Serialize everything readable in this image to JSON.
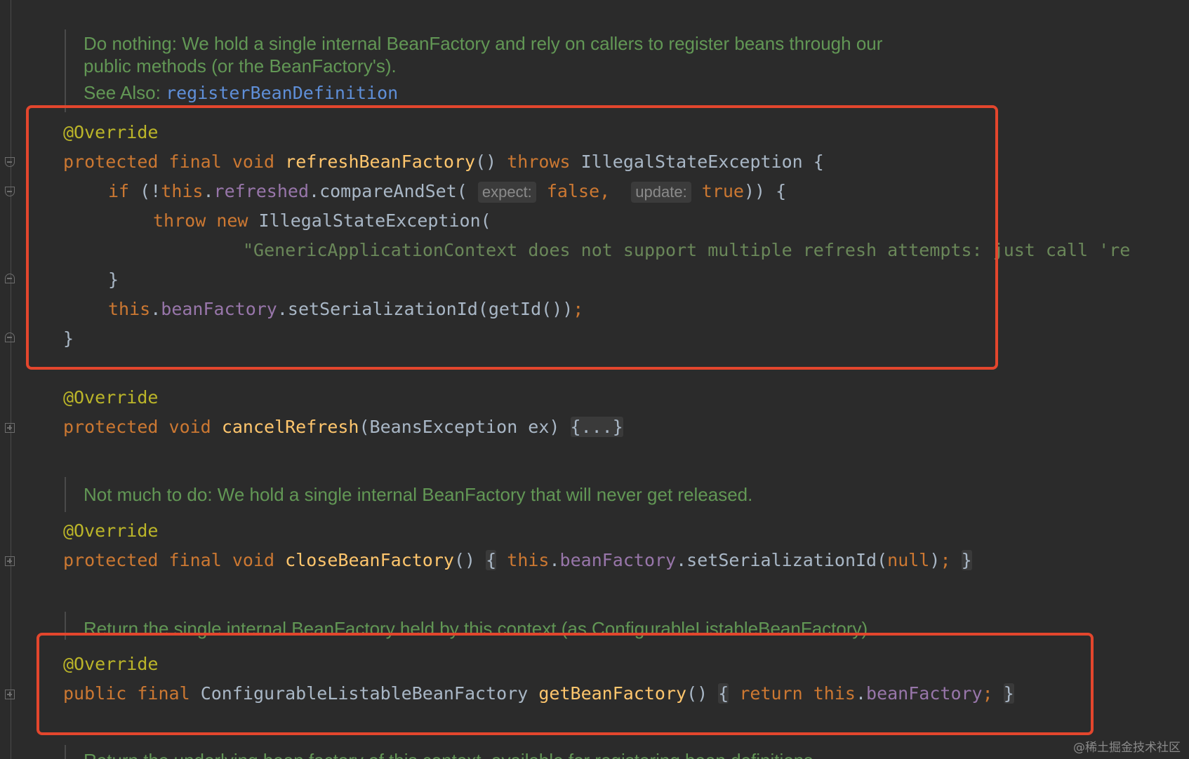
{
  "colors": {
    "background": "#2b2b2b",
    "annotation": "#bbb529",
    "keyword": "#cc7832",
    "method": "#ffc66d",
    "field": "#9876aa",
    "string": "#6a8759",
    "doc_comment": "#629755",
    "highlight_box": "#e3462d"
  },
  "doc1": {
    "line1": "Do nothing: We hold a single internal BeanFactory and rely on callers to register beans through our",
    "line2": "public methods (or the BeanFactory's).",
    "see_also_label": "See Also: ",
    "see_also_link": "registerBeanDefinition"
  },
  "refresh": {
    "annotation": "@Override",
    "kw_protected": "protected",
    "kw_final": "final",
    "kw_void": "void",
    "name": "refreshBeanFactory",
    "parens": "()",
    "kw_throws": "throws",
    "exception_type": "IllegalStateException {",
    "if_kw": "if",
    "if_open": " (!",
    "this1": "this",
    "dot1": ".",
    "field_refreshed": "refreshed",
    "cas_call": ".compareAndSet(",
    "hint_expect": "expect:",
    "val_false": "false",
    "comma": ",",
    "hint_update": "update:",
    "val_true": "true",
    "if_close": ")) {",
    "throw_kw": "throw",
    "new_kw": "new",
    "new_type": "IllegalStateException(",
    "message": "\"GenericApplicationContext does not support multiple refresh attempts: just call 're",
    "close_inner": "}",
    "this2": "this",
    "dot2": ".",
    "field_beanFactory": "beanFactory",
    "set_call": ".setSerializationId(getId())",
    "semicolon": ";",
    "close_outer": "}"
  },
  "cancel": {
    "annotation": "@Override",
    "kw_protected": "protected",
    "kw_void": "void",
    "name": "cancelRefresh",
    "params": "(BeansException ex)",
    "folded": "{...}"
  },
  "doc2": {
    "line1": "Not much to do: We hold a single internal BeanFactory that will never get released."
  },
  "close": {
    "annotation": "@Override",
    "kw_protected": "protected",
    "kw_final": "final",
    "kw_void": "void",
    "name": "closeBeanFactory",
    "parens": "()",
    "open_brace": "{",
    "this_kw": "this",
    "dot": ".",
    "field": "beanFactory",
    "call": ".setSerializationId(",
    "null_kw": "null",
    "call_end": ")",
    "semicolon": ";",
    "close_brace": "}"
  },
  "doc3": {
    "line1": "Return the single internal BeanFactory held by this context (as ConfigurableListableBeanFactory)."
  },
  "get": {
    "annotation": "@Override",
    "kw_public": "public",
    "kw_final": "final",
    "return_type": "ConfigurableListableBeanFactory",
    "name": "getBeanFactory",
    "parens": "()",
    "open_brace": "{",
    "return_kw": "return",
    "this_kw": "this",
    "dot": ".",
    "field": "beanFactory",
    "semicolon": ";",
    "close_brace": "}"
  },
  "doc4": {
    "line1": "Return the underlying bean factory of this context, available for registering bean definitions."
  },
  "watermark": "@稀土掘金技术社区"
}
